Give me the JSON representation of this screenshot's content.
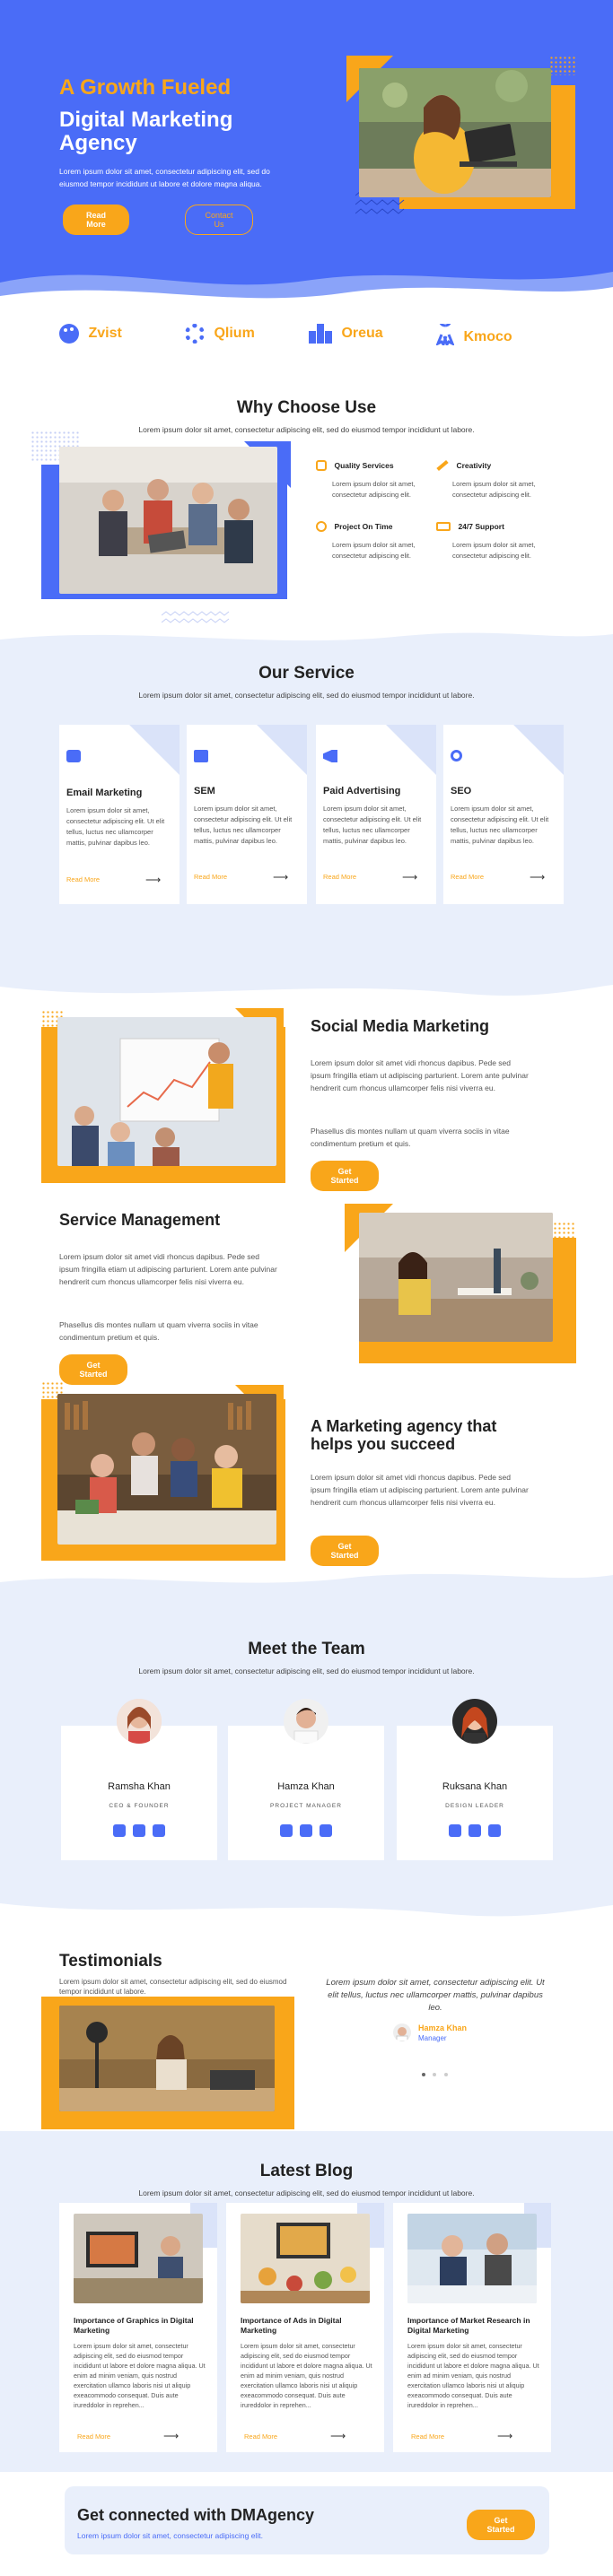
{
  "hero": {
    "title_line1": "A Growth Fueled",
    "title_line2": "Digital Marketing",
    "title_line3": "Agency",
    "text": "Lorem ipsum dolor sit amet, consectetur adipiscing elit, sed do eiusmod tempor incididunt ut labore et dolore magna aliqua.",
    "btn_primary": "Read More",
    "btn_secondary": "Contact Us"
  },
  "logos": [
    {
      "name": "Zvist",
      "icon": "palette-icon"
    },
    {
      "name": "Qlium",
      "icon": "gear-icon"
    },
    {
      "name": "Oreua",
      "icon": "blocks-icon"
    },
    {
      "name": "Kmoco",
      "icon": "ribbon-icon"
    }
  ],
  "why": {
    "title": "Why Choose Use",
    "subtitle": "Lorem ipsum dolor sit amet, consectetur adipiscing elit, sed do eiusmod tempor incididunt ut labore.",
    "features": [
      {
        "title": "Quality Services",
        "text": "Lorem ipsum dolor sit amet, consectetur adipiscing elit."
      },
      {
        "title": "Creativity",
        "text": "Lorem ipsum dolor sit amet, consectetur adipiscing elit."
      },
      {
        "title": "Project On Time",
        "text": "Lorem ipsum dolor sit amet, consectetur adipiscing elit."
      },
      {
        "title": "24/7 Support",
        "text": "Lorem ipsum dolor sit amet, consectetur adipiscing elit."
      }
    ]
  },
  "services": {
    "title": "Our Service",
    "subtitle": "Lorem ipsum dolor sit amet, consectetur adipiscing elit, sed do eiusmod tempor incididunt ut labore.",
    "items": [
      {
        "title": "Email Marketing",
        "text": "Lorem ipsum dolor sit amet, consectetur adipiscing elit. Ut elit tellus, luctus nec ullamcorper mattis, pulvinar dapibus leo.",
        "link": "Read More"
      },
      {
        "title": "SEM",
        "text": "Lorem ipsum dolor sit amet, consectetur adipiscing elit. Ut elit tellus, luctus nec ullamcorper mattis, pulvinar dapibus leo.",
        "link": "Read More"
      },
      {
        "title": "Paid Advertising",
        "text": "Lorem ipsum dolor sit amet, consectetur adipiscing elit. Ut elit tellus, luctus nec ullamcorper mattis, pulvinar dapibus leo.",
        "link": "Read More"
      },
      {
        "title": "SEO",
        "text": "Lorem ipsum dolor sit amet, consectetur adipiscing elit. Ut elit tellus, luctus nec ullamcorper mattis, pulvinar dapibus leo.",
        "link": "Read More"
      }
    ]
  },
  "features": [
    {
      "title": "Social Media Marketing",
      "p1": "Lorem ipsum dolor sit amet vidi rhoncus dapibus. Pede sed ipsum fringilla etiam ut adipiscing parturient. Lorem ante pulvinar hendrerit cum rhoncus ullamcorper felis nisi viverra eu.",
      "p2": "Phasellus dis montes nullam ut quam viverra sociis in vitae condimentum pretium et quis.",
      "btn": "Get Started"
    },
    {
      "title": "Service Management",
      "p1": "Lorem ipsum dolor sit amet vidi rhoncus dapibus. Pede sed ipsum fringilla etiam ut adipiscing parturient. Lorem ante pulvinar hendrerit cum rhoncus ullamcorper felis nisi viverra eu.",
      "p2": "Phasellus dis montes nullam ut quam viverra sociis in vitae condimentum pretium et quis.",
      "btn": "Get Started"
    },
    {
      "title": "A Marketing agency that helps you succeed",
      "p1": "Lorem ipsum dolor sit amet vidi rhoncus dapibus. Pede sed ipsum fringilla etiam ut adipiscing parturient. Lorem ante pulvinar hendrerit cum rhoncus ullamcorper felis nisi viverra eu.",
      "btn": "Get Started"
    }
  ],
  "team": {
    "title": "Meet the Team",
    "subtitle": "Lorem ipsum dolor sit amet, consectetur adipiscing elit, sed do eiusmod tempor incididunt ut labore.",
    "members": [
      {
        "name": "Ramsha Khan",
        "role": "CEO & FOUNDER"
      },
      {
        "name": "Hamza Khan",
        "role": "PROJECT MANAGER"
      },
      {
        "name": "Ruksana Khan",
        "role": "DESIGN LEADER"
      }
    ]
  },
  "testimonials": {
    "title": "Testimonials",
    "subtitle": "Lorem ipsum dolor sit amet, consectetur adipiscing elit, sed do eiusmod tempor incididunt ut labore.",
    "quote": "Lorem ipsum dolor sit amet, consectetur adipiscing elit. Ut elit tellus, luctus nec ullamcorper mattis, pulvinar dapibus leo.",
    "author": "Hamza Khan",
    "author_role": "Manager"
  },
  "blog": {
    "title": "Latest Blog",
    "subtitle": "Lorem ipsum dolor sit amet, consectetur adipiscing elit, sed do eiusmod tempor incididunt ut labore.",
    "posts": [
      {
        "title": "Importance of Graphics in Digital Marketing",
        "text": "Lorem ipsum dolor sit amet, consectetur adipiscing elit, sed do eiusmod tempor incididunt ut labore et dolore magna aliqua. Ut enim ad minim veniam, quis nostrud exercitation ullamco laboris nisi ut aliquip exeacommodo consequat. Duis aute irureddolor in reprehen...",
        "link": "Read More"
      },
      {
        "title": "Importance of Ads in Digital Marketing",
        "text": "Lorem ipsum dolor sit amet, consectetur adipiscing elit, sed do eiusmod tempor incididunt ut labore et dolore magna aliqua. Ut enim ad minim veniam, quis nostrud exercitation ullamco laboris nisi ut aliquip exeacommodo consequat. Duis aute irureddolor in reprehen...",
        "link": "Read More"
      },
      {
        "title": "Importance of Market Research in Digital Marketing",
        "text": "Lorem ipsum dolor sit amet, consectetur adipiscing elit, sed do eiusmod tempor incididunt ut labore et dolore magna aliqua. Ut enim ad minim veniam, quis nostrud exercitation ullamco laboris nisi ut aliquip exeacommodo consequat. Duis aute irureddolor in reprehen...",
        "link": "Read More"
      }
    ]
  },
  "cta": {
    "title": "Get connected with DMAgency",
    "text": "Lorem ipsum dolor sit amet, consectetur adipiscing elit.",
    "btn": "Get Started"
  },
  "colors": {
    "primary": "#4a6cf7",
    "accent": "#f9a61a",
    "light": "#e9effb"
  }
}
